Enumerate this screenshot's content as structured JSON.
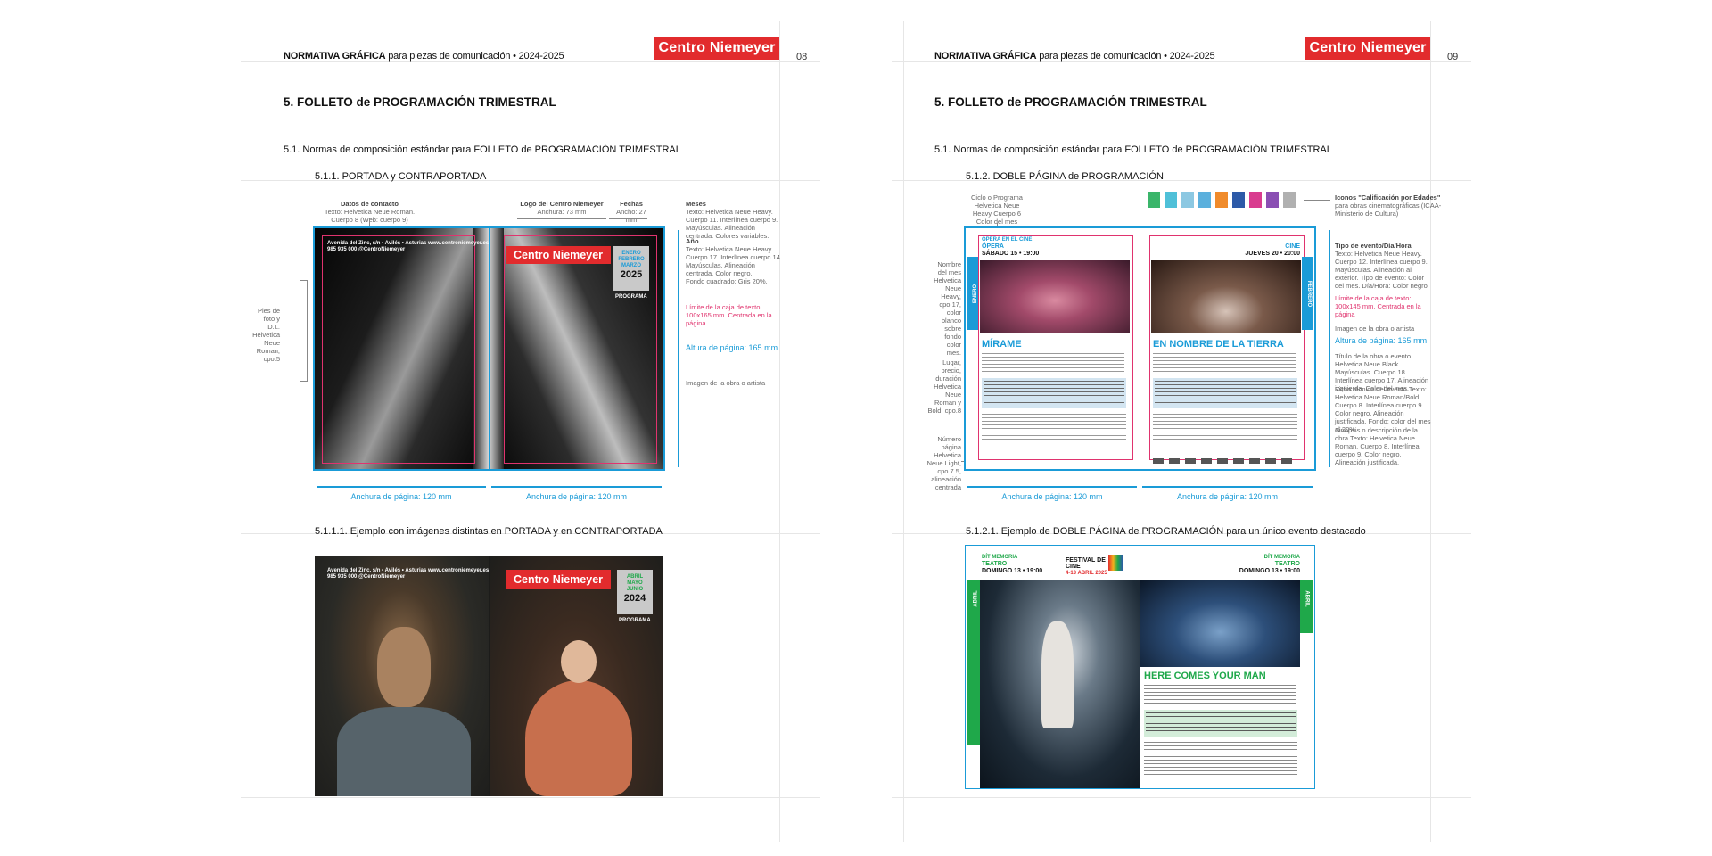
{
  "header": {
    "title_bold": "NORMATIVA GRÁFICA",
    "title_rest": " para piezas de comunicación • 2024-2025",
    "brand": "Centro Niemeyer",
    "page_left": "08",
    "page_right": "09"
  },
  "left": {
    "section": "5.  FOLLETO de PROGRAMACIÓN TRIMESTRAL",
    "subsection": "5.1. Normas de composición estándar para FOLLETO de PROGRAMACIÓN TRIMESTRAL",
    "subsubsection": "5.1.1. PORTADA y CONTRAPORTADA",
    "ann_contact_title": "Datos de contacto",
    "ann_contact_body": "Texto: Helvetica Neue Roman. Cuerpo 8 (Web: cuerpo 9)",
    "ann_logo_title": "Logo del Centro Niemeyer",
    "ann_logo_body": "Anchura: 73 mm",
    "ann_dates_title": "Fechas",
    "ann_dates_body": "Ancho: 27 mm",
    "ann_months_title": "Meses",
    "ann_months_body": "Texto: Helvetica Neue Heavy. Cuerpo 11. Interlínea cuerpo 9. Mayúsculas. Alineación centrada. Colores variables.",
    "ann_year_title": "Año",
    "ann_year_body": "Texto: Helvetica Neue Heavy. Cuerpo 17. Interlínea cuerpo 14. Mayúsculas. Alineación centrada. Color negro.",
    "ann_square": "Fondo cuadrado: Gris 20%.",
    "ann_textbox": "Límite de la caja de texto: 100x165 mm. Centrada en la página",
    "ann_height": "Altura de página: 165 mm",
    "ann_image": "Imagen de la obra o artista",
    "ann_foot": "Pies de foto y D.L. Helvetica Neue Roman, cpo.5",
    "width_label_1": "Anchura de página: 120 mm",
    "width_label_2": "Anchura de página: 120 mm",
    "cover": {
      "brand": "Centro Niemeyer",
      "months": [
        "ENERO",
        "FEBRERO",
        "MARZO"
      ],
      "year": "2025",
      "programa": "PROGRAMA",
      "contact": "Avenida del Zinc, s/n • Avilés • Asturias",
      "web": "www.centroniemeyer.es",
      "phone": "985 935 000",
      "handle": "@CentroNiemeyer"
    },
    "example_title": "5.1.1.1. Ejemplo con imágenes distintas en PORTADA y en CONTRAPORTADA",
    "example_cover": {
      "brand": "Centro Niemeyer",
      "months": [
        "ABRIL",
        "MAYO",
        "JUNIO"
      ],
      "year": "2024",
      "programa": "PROGRAMA",
      "contact": "Avenida del Zinc, s/n • Avilés • Asturias",
      "web": "www.centroniemeyer.es",
      "phone": "985 935 000",
      "handle": "@CentroNiemeyer"
    }
  },
  "right": {
    "section": "5.  FOLLETO de PROGRAMACIÓN TRIMESTRAL",
    "subsection": "5.1. Normas de composición estándar para FOLLETO de PROGRAMACIÓN TRIMESTRAL",
    "subsubsection": "5.1.2. DOBLE PÁGINA de PROGRAMACIÓN",
    "ann_cycle": "Ciclo o Programa Helvetica Neue Heavy Cuerpo 6 Color del mes",
    "ann_icons_title": "Iconos \"Calificación por Edades\"",
    "ann_icons_body": "para obras cinematográficas (ICAA-Ministerio de Cultura)",
    "ann_month_name": "Nombre del mes Helvetica Neue Heavy, cpo.17, color blanco sobre fondo color mes.",
    "ann_place": "Lugar, precio, duración Helvetica Neue Roman y Bold, cpo.8",
    "ann_pagenum": "Número página Helvetica Neue Light, cpo.7.5, alineación centrada",
    "ann_event_title": "Tipo de evento/Día/Hora",
    "ann_event_body": "Texto: Helvetica Neue Heavy. Cuerpo 12. Interlínea cuerpo 9. Mayúsculas. Alineación al exterior. Tipo de evento: Color del mes. Día/Hora: Color negro",
    "ann_textbox": "Límite de la caja de texto: 100x145 mm. Centrada en la página",
    "ann_image": "Imagen de la obra o artista",
    "ann_height": "Altura de página: 165 mm",
    "ann_worktitle": "Título de la obra o evento Helvetica Neue Black. Mayúsculas. Cuerpo 18. Interlínea cuerpo 17. Alineación izquierda. Color del mes.",
    "ann_tech": "Ficha técnica del evento Texto: Helvetica Neue Roman/Bold. Cuerpo 8. Interlínea cuerpo 9. Color negro. Alineación justificada. Fondo: color del mes al 20%.",
    "ann_synopsis": "Sinopsis o descripción de la obra Texto: Helvetica Neue Roman. Cuerpo 8. Interlínea cuerpo 9. Color negro. Alineación justificada.",
    "width_label_1": "Anchura de página: 120 mm",
    "width_label_2": "Anchura de página: 120 mm",
    "spread": {
      "left_type": "ÓPERA",
      "left_cycle": "ÓPERA EN EL CINE",
      "left_day": "SÁBADO 15 • 19:00",
      "left_title": "MÍRAME",
      "left_month": "ENERO",
      "right_type": "CINE",
      "right_day": "JUEVES 20 • 20:00",
      "right_title": "EN NOMBRE DE LA TIERRA",
      "right_month": "FEBRERO"
    },
    "example_title": "5.1.2.1. Ejemplo de DOBLE PÁGINA de PROGRAMACIÓN para un único evento destacado",
    "example": {
      "type": "TEATRO",
      "cycle": "DÍT MEMORIA",
      "day": "DOMINGO 13 • 19:00",
      "festival": "FESTIVAL DE CINE",
      "festival_dates": "4-13 ABRIL 2025",
      "title": "HERE COMES YOUR MAN",
      "month": "ABRIL"
    }
  },
  "colors": {
    "brand_red": "#e22b2d",
    "dimension_blue": "#1a9bd7",
    "textbox_pink": "#e0336e",
    "enero_blue": "#1a9bd7",
    "abril_green": "#1fa84a"
  }
}
